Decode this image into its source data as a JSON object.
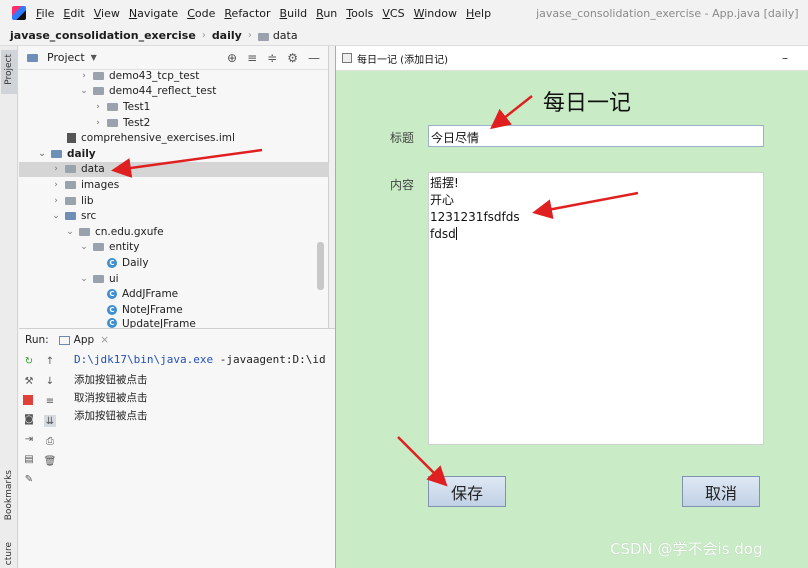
{
  "menubar": {
    "items": [
      "File",
      "Edit",
      "View",
      "Navigate",
      "Code",
      "Refactor",
      "Build",
      "Run",
      "Tools",
      "VCS",
      "Window",
      "Help"
    ],
    "window_title": "javase_consolidation_exercise - App.java [daily]"
  },
  "breadcrumb": {
    "project": "javase_consolidation_exercise",
    "module": "daily",
    "folder": "data"
  },
  "left_strip": {
    "project_label": "Project",
    "bookmarks_label": "Bookmarks",
    "structure_label": "cture"
  },
  "project_panel": {
    "title": "Project",
    "tree": [
      {
        "label": "demo43_tcp_test",
        "icon": "folder-icon"
      },
      {
        "label": "demo44_reflect_test",
        "icon": "folder-icon"
      },
      {
        "label": "Test1",
        "icon": "folder-icon"
      },
      {
        "label": "Test2",
        "icon": "folder-icon"
      },
      {
        "label": "comprehensive_exercises.iml",
        "icon": "iml-file-icon"
      },
      {
        "label": "daily",
        "icon": "module-folder-icon"
      },
      {
        "label": "data",
        "icon": "folder-icon"
      },
      {
        "label": "images",
        "icon": "folder-icon"
      },
      {
        "label": "lib",
        "icon": "folder-icon"
      },
      {
        "label": "src",
        "icon": "source-folder-icon"
      },
      {
        "label": "cn.edu.gxufe",
        "icon": "package-icon"
      },
      {
        "label": "entity",
        "icon": "package-icon"
      },
      {
        "label": "Daily",
        "icon": "class-icon"
      },
      {
        "label": "ui",
        "icon": "package-icon"
      },
      {
        "label": "AddJFrame",
        "icon": "class-icon"
      },
      {
        "label": "NoteJFrame",
        "icon": "class-icon"
      },
      {
        "label": "UpdateJFrame",
        "icon": "class-icon"
      }
    ]
  },
  "run_panel": {
    "label": "Run:",
    "tab": "App",
    "command": "D:\\jdk17\\bin\\java.exe",
    "command_rest": " -javaagent:D:\\id",
    "lines": [
      "添加按钮被点击",
      "取消按钮被点击",
      "添加按钮被点击"
    ]
  },
  "dialog": {
    "window_title": "每日一记 (添加日记)",
    "minimize": "–",
    "heading": "每日一记",
    "title_label": "标题",
    "title_value": "今日尽情",
    "content_label": "内容",
    "content_lines": [
      "摇摆!",
      "开心",
      "1231231fsdfds",
      "fdsd"
    ],
    "save_label": "保存",
    "cancel_label": "取消"
  },
  "watermark": "CSDN @学不会is dog",
  "colors": {
    "dialog_bg": "#c9ecc6",
    "arrow": "#e02020",
    "selection": "#d5d5d5"
  }
}
